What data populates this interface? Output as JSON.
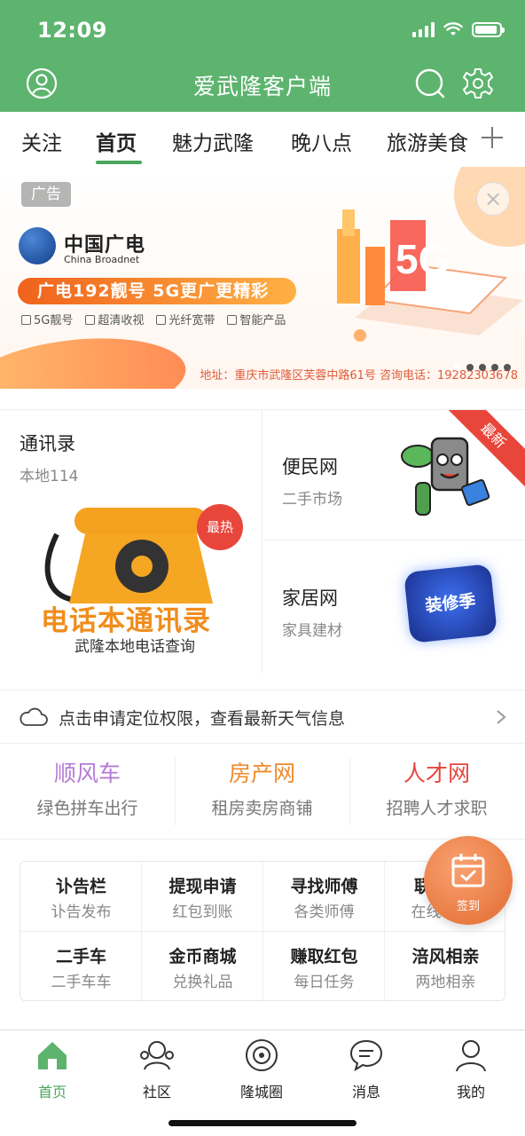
{
  "status_bar": {
    "time": "12:09"
  },
  "header": {
    "title": "爱武隆客户端"
  },
  "tabs": [
    {
      "label": "关注",
      "active": false
    },
    {
      "label": "首页",
      "active": true
    },
    {
      "label": "魅力武隆",
      "active": false
    },
    {
      "label": "晚八点",
      "active": false
    },
    {
      "label": "旅游美食",
      "active": false
    }
  ],
  "banner": {
    "ad_tag": "广告",
    "brand_cn": "中国广电",
    "brand_en": "China Broadnet",
    "promo": "广电192靓号 5G更广更精彩",
    "features": [
      "5G靓号",
      "超清收视",
      "光纤宽带",
      "智能产品"
    ],
    "address": "地址：重庆市武隆区芙蓉中路61号   咨询电话：19282303678",
    "colors": {
      "accent": "#f0621c",
      "brand": "#103e8a"
    }
  },
  "cards": {
    "phonebook": {
      "title": "通讯录",
      "subtitle": "本地114",
      "badge": "最热",
      "art_title": "电话本通讯录",
      "art_subtitle": "武隆本地电话查询"
    },
    "bianmin": {
      "title": "便民网",
      "subtitle": "二手市场",
      "ribbon": "最新"
    },
    "jiaju": {
      "title": "家居网",
      "subtitle": "家具建材",
      "badge": "装修季"
    }
  },
  "weather": {
    "text": "点击申请定位权限，查看最新天气信息"
  },
  "quick_links": [
    {
      "title": "顺风车",
      "subtitle": "绿色拼车出行",
      "color": "#b57ad6"
    },
    {
      "title": "房产网",
      "subtitle": "租房卖房商铺",
      "color": "#f08a2c"
    },
    {
      "title": "人才网",
      "subtitle": "招聘人才求职",
      "color": "#e7463f"
    }
  ],
  "grid": [
    {
      "title": "讣告栏",
      "subtitle": "讣告发布"
    },
    {
      "title": "提现申请",
      "subtitle": "红包到账"
    },
    {
      "title": "寻找师傅",
      "subtitle": "各类师傅"
    },
    {
      "title": "联",
      "subtitle": "在线"
    },
    {
      "title": "二手车",
      "subtitle": "二手车车"
    },
    {
      "title": "金币商城",
      "subtitle": "兑换礼品"
    },
    {
      "title": "赚取红包",
      "subtitle": "每日任务"
    },
    {
      "title": "涪风相亲",
      "subtitle": "两地相亲"
    }
  ],
  "signin": {
    "label": "签到"
  },
  "bottom_nav": [
    {
      "label": "首页",
      "icon": "home-icon",
      "active": true
    },
    {
      "label": "社区",
      "icon": "community-icon",
      "active": false
    },
    {
      "label": "隆城圈",
      "icon": "circle-icon",
      "active": false
    },
    {
      "label": "消息",
      "icon": "message-icon",
      "active": false
    },
    {
      "label": "我的",
      "icon": "profile-icon",
      "active": false
    }
  ],
  "colors": {
    "primary": "#5db46f",
    "active_tab": "#4aa65c",
    "badge_red": "#e8463b"
  }
}
